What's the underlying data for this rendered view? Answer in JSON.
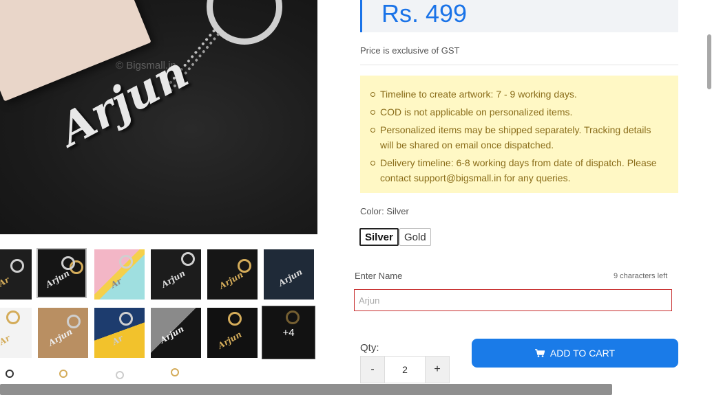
{
  "product": {
    "watermark": "© Bigsmall.in",
    "hero_name_text": "Arjun",
    "more_images_label": "+4"
  },
  "price": {
    "amount": "Rs. 499",
    "gst_note": "Price is exclusive of GST"
  },
  "notice": {
    "items": [
      "Timeline to create artwork: 7 - 9 working days.",
      "COD is not applicable on personalized items.",
      "Personalized items may be shipped separately. Tracking details will be shared on email once dispatched.",
      "Delivery timeline: 6-8 working days from date of dispatch. Please contact support@bigsmall.in for any queries."
    ],
    "bg_color": "#fff8c5",
    "text_color": "#8a6d1a"
  },
  "color_option": {
    "label": "Color: Silver",
    "options": [
      "Silver",
      "Gold"
    ],
    "selected": "Silver"
  },
  "name_field": {
    "label": "Enter Name",
    "chars_left": "9 characters left",
    "placeholder": "Arjun"
  },
  "quantity": {
    "label": "Qty:",
    "value": "2",
    "decrement": "-",
    "increment": "+"
  },
  "cart": {
    "button_label": "ADD TO CART",
    "icon": "cart-icon"
  },
  "colors": {
    "accent": "#1a73e8",
    "cart_button": "#1a7be8",
    "error_border": "#c62828"
  }
}
